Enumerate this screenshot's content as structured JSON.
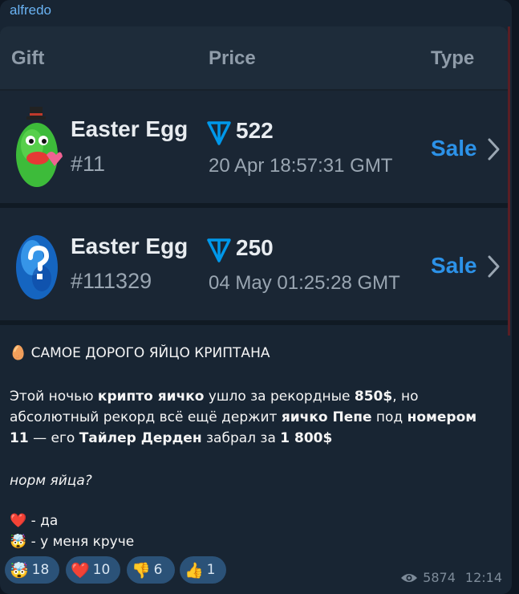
{
  "sender": "alfredo",
  "table": {
    "headers": {
      "gift": "Gift",
      "price": "Price",
      "type": "Type"
    },
    "rows": [
      {
        "name": "Easter Egg",
        "number": "#11",
        "price": "522",
        "date": "20 Apr 18:57:31 GMT",
        "type": "Sale"
      },
      {
        "name": "Easter Egg",
        "number": "#111329",
        "price": "250",
        "date": "04 May 01:25:28 GMT",
        "type": "Sale"
      }
    ]
  },
  "message": {
    "title_emoji": "🥚",
    "title": "САМОЕ ДОРОГО ЯЙЦО КРИПТАНА",
    "p1": [
      "Этой ночью ",
      "крипто яичко",
      " ушло за рекордные ",
      "850$",
      ", но",
      "абсолютный рекорд всё ещё держит ",
      "яичко Пепе",
      " под ",
      "номером",
      "11",
      " — его ",
      "Тайлер Дерден",
      " забрал за ",
      "1 800$"
    ],
    "question": "норм яйца?",
    "opt1_emoji": "❤️",
    "opt1": " - да",
    "opt2_emoji": "🤯",
    "opt2": " - у меня круче"
  },
  "reactions": [
    {
      "emoji": "🤯",
      "count": "18"
    },
    {
      "emoji": "❤️",
      "count": "10"
    },
    {
      "emoji": "👎",
      "count": "6"
    },
    {
      "emoji": "👍",
      "count": "1"
    }
  ],
  "meta": {
    "views": "5874",
    "time": "12:14"
  },
  "colors": {
    "accent": "#2c92e8",
    "ton": "#0098ea",
    "bubble": "#182533",
    "reaction_bg": "#2b5278"
  }
}
